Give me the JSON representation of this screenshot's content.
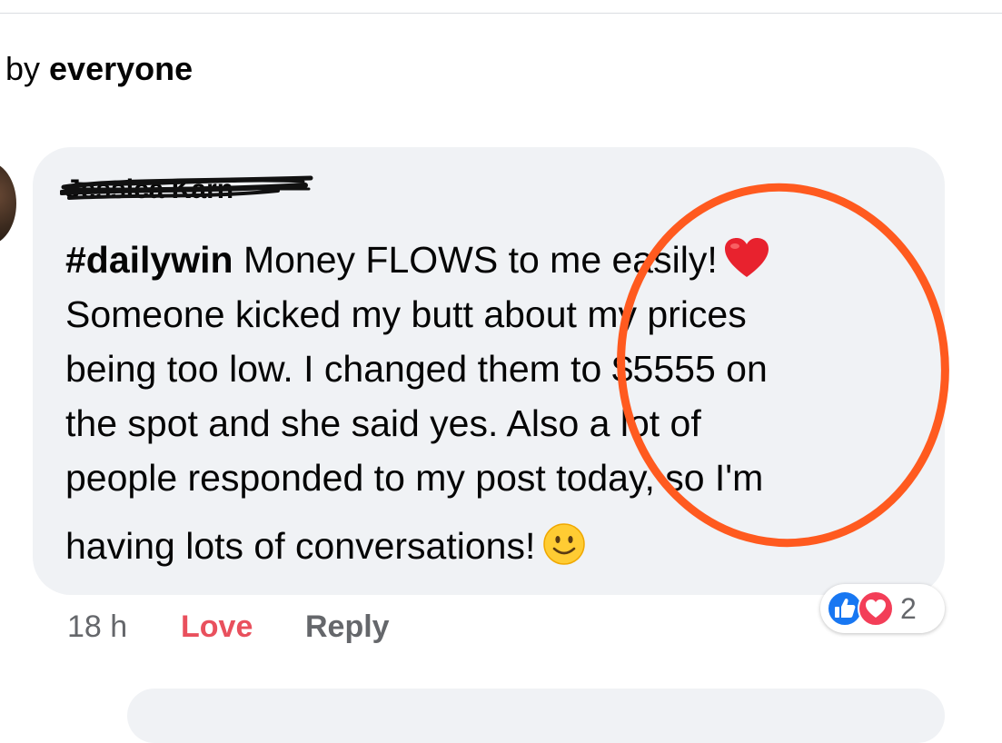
{
  "sort": {
    "prefix": "by ",
    "value": "everyone"
  },
  "comment": {
    "author": "Jessica Karn",
    "lines": [
      {
        "hashtag": "#dailywin",
        "text": " Money FLOWS to me easily!"
      },
      {
        "text": "Someone kicked my butt about my prices"
      },
      {
        "text": "being too low. I changed them to $5555 on"
      },
      {
        "text": "the spot and she said yes. Also a lot of"
      },
      {
        "text": "people responded to my post today, so I'm"
      },
      {
        "text": "having lots of conversations!"
      }
    ],
    "emojis": {
      "line1": "red-heart",
      "line6": "slightly-smiling-face"
    },
    "annotation": {
      "shape": "ellipse",
      "color": "#ff5a1f"
    },
    "scribble_color": "#111111"
  },
  "meta": {
    "time": "18 h",
    "love_label": "Love",
    "reply_label": "Reply"
  },
  "reactions": {
    "types": [
      "like",
      "love"
    ],
    "count": "2",
    "like_color": "#1877f2",
    "love_color": "#f33e58"
  }
}
